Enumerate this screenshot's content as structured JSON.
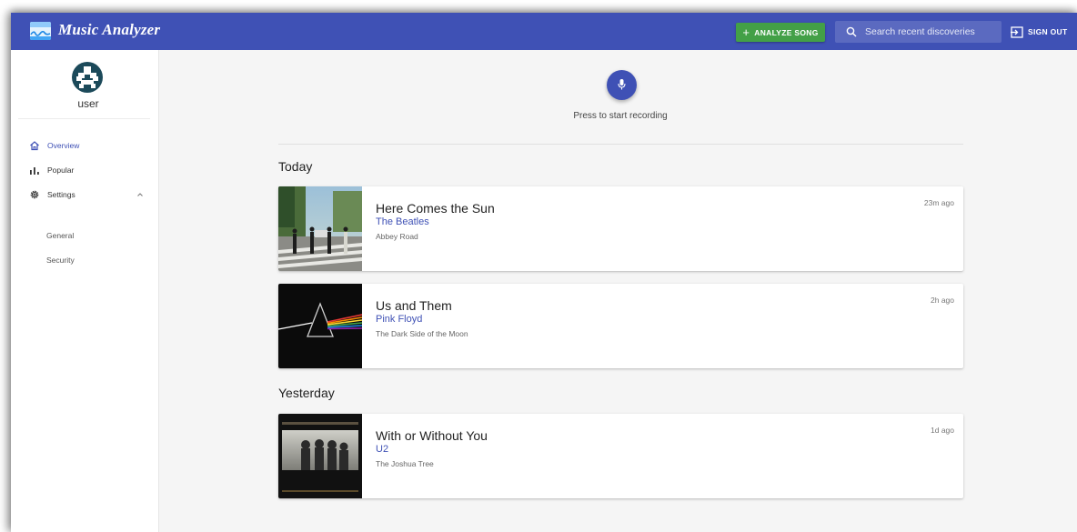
{
  "app": {
    "title": "Music Analyzer"
  },
  "header": {
    "analyze_label": "ANALYZE SONG",
    "search_placeholder": "Search recent discoveries",
    "signout_label": "SIGN OUT"
  },
  "sidebar": {
    "username": "user",
    "items": [
      {
        "label": "Overview",
        "icon": "home-icon",
        "active": true
      },
      {
        "label": "Popular",
        "icon": "bar-chart-icon",
        "active": false
      },
      {
        "label": "Settings",
        "icon": "gear-icon",
        "active": false,
        "expanded": true
      }
    ],
    "settings_sub": [
      {
        "label": "General"
      },
      {
        "label": "Security"
      }
    ]
  },
  "recorder": {
    "label": "Press to start recording"
  },
  "sections": [
    {
      "title": "Today",
      "songs": [
        {
          "title": "Here Comes the Sun",
          "artist": "The Beatles",
          "album": "Abbey Road",
          "time": "23m ago"
        },
        {
          "title": "Us and Them",
          "artist": "Pink Floyd",
          "album": "The Dark Side of the Moon",
          "time": "2h ago"
        }
      ]
    },
    {
      "title": "Yesterday",
      "songs": [
        {
          "title": "With or Without You",
          "artist": "U2",
          "album": "The Joshua Tree",
          "time": "1d ago"
        }
      ]
    }
  ],
  "colors": {
    "primary": "#3f51b5",
    "accent_green": "#43a047",
    "background": "#f5f5f5"
  }
}
